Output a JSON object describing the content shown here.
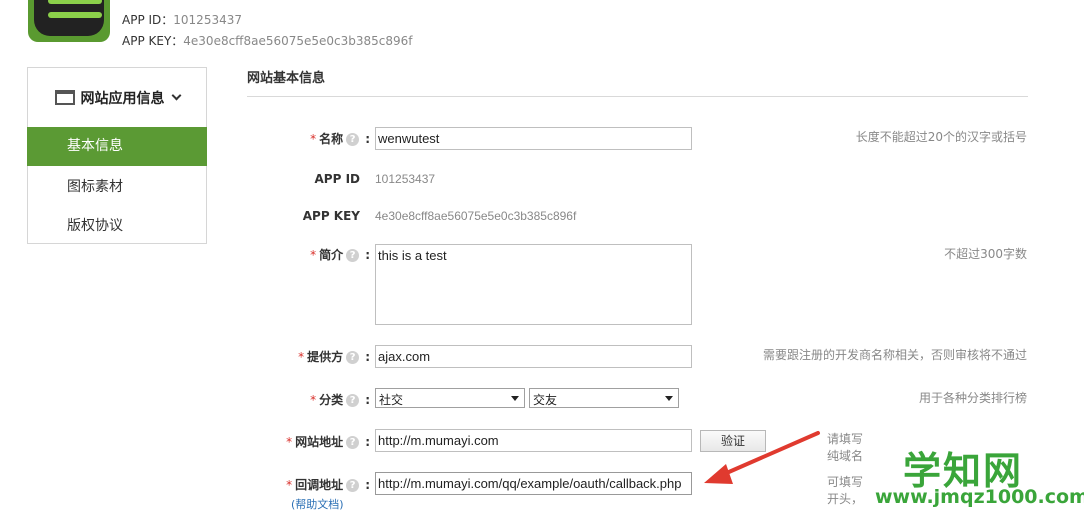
{
  "app": {
    "id_label": "APP ID：",
    "id_value": "101253437",
    "key_label": "APP KEY：",
    "key_value": "4e30e8cff8ae56075e5e0c3b385c896f"
  },
  "sidebar": {
    "title": "网站应用信息",
    "items": [
      {
        "label": "基本信息",
        "active": true
      },
      {
        "label": "图标素材",
        "active": false
      },
      {
        "label": "版权协议",
        "active": false
      }
    ]
  },
  "section": {
    "title": "网站基本信息"
  },
  "form": {
    "name": {
      "label": "名称",
      "value": "wenwutest",
      "hint": "长度不能超过20个的汉字或括号"
    },
    "app_id": {
      "label": "APP ID",
      "value": "101253437"
    },
    "app_key": {
      "label": "APP KEY",
      "value": "4e30e8cff8ae56075e5e0c3b385c896f"
    },
    "intro": {
      "label": "简介",
      "value": "this is a test",
      "hint": "不超过300字数"
    },
    "provider": {
      "label": "提供方",
      "value": "ajax.com",
      "hint": "需要跟注册的开发商名称相关，否则审核将不通过"
    },
    "category": {
      "label": "分类",
      "primary": "社交",
      "secondary": "交友",
      "hint": "用于各种分类排行榜"
    },
    "site_url": {
      "label": "网站地址",
      "value": "http://m.mumayi.com",
      "verify_button": "验证",
      "hint_line1": "请填写",
      "hint_line2": "纯域名"
    },
    "callback": {
      "label": "回调地址",
      "value": "http://m.mumayi.com/qq/example/oauth/callback.php",
      "help_link": "(帮助文档)",
      "hint_line1": "可填写",
      "hint_line2": "开头，"
    }
  },
  "symbols": {
    "required": "*",
    "help": "?",
    "colon": ":"
  },
  "watermark": {
    "text": "学知网",
    "url": "www.jmqz1000.com"
  },
  "colors": {
    "accent": "#5b9a34",
    "required": "#d9302b",
    "link": "#2a6fb5",
    "arrow": "#e03a2f",
    "watermark": "#3aa53a"
  }
}
